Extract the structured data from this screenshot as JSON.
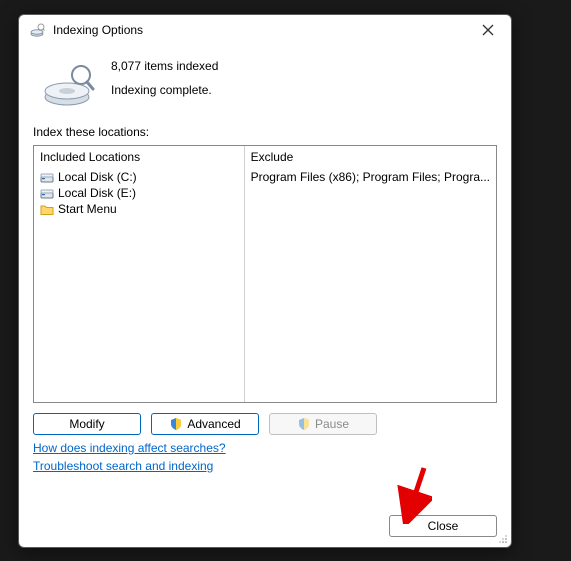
{
  "dialog": {
    "title": "Indexing Options",
    "items_indexed": "8,077 items indexed",
    "status": "Indexing complete.",
    "locations_label": "Index these locations:",
    "columns": {
      "included": "Included Locations",
      "exclude": "Exclude"
    },
    "locations": [
      {
        "label": "Local Disk (C:)",
        "exclude": "Program Files (x86); Program Files; Progra..."
      },
      {
        "label": "Local Disk (E:)",
        "exclude": ""
      },
      {
        "label": "Start Menu",
        "exclude": ""
      }
    ],
    "buttons": {
      "modify": "Modify",
      "advanced": "Advanced",
      "pause": "Pause",
      "close": "Close"
    },
    "links": {
      "how": "How does indexing affect searches?",
      "troubleshoot": "Troubleshoot search and indexing"
    }
  }
}
